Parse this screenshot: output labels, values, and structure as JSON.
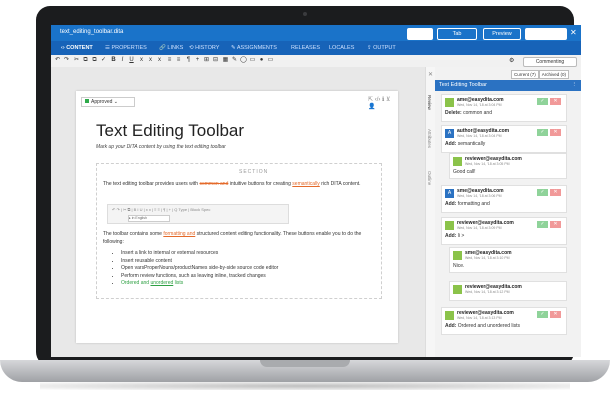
{
  "app": {
    "file_name": "text_editing_toolbar.dita",
    "buttons": {
      "oxygen": "Oxygen",
      "tab": "Tab",
      "preview": "Preview",
      "publish": "Publish",
      "close": "✕"
    }
  },
  "nav": [
    "CONTENT",
    "PROPERTIES",
    "LINKS",
    "HISTORY",
    "ASSIGNMENTS",
    "RELEASES",
    "LOCALES",
    "OUTPUT"
  ],
  "nav_icons": [
    "‹›",
    "☰",
    "🔗",
    "⟲",
    "✎",
    "",
    "",
    "⇪"
  ],
  "toolbar": {
    "tools": [
      "↶",
      "↷",
      "✂",
      "⧉",
      "⧉",
      "✓",
      "B",
      "I",
      "U",
      "x",
      "x",
      "x",
      "≡",
      "≡",
      "¶",
      "+",
      "⊞",
      "⊟",
      "▦",
      "✎",
      "◯",
      "▭",
      "●",
      "▭"
    ],
    "commenting": "Commenting",
    "gear": "⚙"
  },
  "doc": {
    "status": "Approved",
    "status_arrow": "⌄",
    "tools": "⇱ ‹/› ℹ ⊻",
    "person": "👤",
    "title": "Text Editing Toolbar",
    "shortdesc": "Mark up your DITA content by using the text editing toolbar",
    "section_label": "SECTION",
    "p1_a": "The text editing toolbar provides users with",
    "p1_strike": "common and",
    "p1_b": "intuitive buttons for creating",
    "p1_ins": "semantically",
    "p1_c": "rich DITA content.",
    "mini_row": "↶ ↷ | ✂ ⧉ | B I U | x x | ≡ ≡ | ¶ | + | Q Type | Block Spec",
    "mini_field": "▸ in English",
    "p2_a": "The toolbar contains some",
    "p2_ins": "formatting and",
    "p2_b": "structured content editing functionality. These buttons enable you to do the following:",
    "bullets": [
      "Insert a link to internal or external resources",
      "Insert reusable content",
      "Open varsProperNouns/productNames side-by-side source code editor",
      "Perform review functions, such as leaving inline, tracked changes"
    ],
    "bullet_last_a": "Ordered and ",
    "bullet_last_b": "unordered",
    "bullet_last_c": " lists"
  },
  "side_strip": [
    "Review",
    "Attributes",
    "Outline"
  ],
  "side_strip_close": "✕",
  "review": {
    "tabs": [
      "Current (7)",
      "Archived (0)"
    ],
    "header": "Text Editing Toolbar",
    "header_more": "⋮",
    "ok_label": "✓",
    "no_label": "✕",
    "cards": [
      {
        "avatar": "",
        "who": "ame@easydita.com",
        "when": "Wed, Nov 14, '18 at 3:04 PM",
        "msg_label": "Delete:",
        "msg": "common and",
        "blue": false
      },
      {
        "avatar": "A",
        "who": "author@easydita.com",
        "when": "Wed, Nov 14, '18 at 3:04 PM",
        "msg_label": "Add:",
        "msg": "semantically",
        "blue": true
      },
      {
        "avatar": "",
        "who": "reviewer@easydita.com",
        "when": "Wed, Nov 14, '18 at 3:05 PM",
        "msg_label": "",
        "msg": "Good call!",
        "blue": false
      },
      {
        "avatar": "A",
        "who": "sme@easydita.com",
        "when": "Wed, Nov 14, '18 at 3:06 PM",
        "msg_label": "Add:",
        "msg": "formatting and",
        "blue": true
      },
      {
        "avatar": "",
        "who": "reviewer@easydita.com",
        "when": "Wed, Nov 14, '18 at 3:09 PM",
        "msg_label": "Add:",
        "msg": "li >",
        "blue": false
      },
      {
        "avatar": "",
        "who": "sme@easydita.com",
        "when": "Wed, Nov 14, '18 at 3:10 PM",
        "msg_label": "",
        "msg": "Nice.",
        "blue": false
      },
      {
        "avatar": "",
        "who": "reviewer@easydita.com",
        "when": "Wed, Nov 14, '18 at 3:12 PM",
        "msg_label": "",
        "msg": "",
        "blue": false
      },
      {
        "avatar": "",
        "who": "reviewer@easydita.com",
        "when": "Wed, Nov 14, '18 at 3:13 PM",
        "msg_label": "Add:",
        "msg": "Ordered and unordered lists",
        "blue": false
      }
    ]
  }
}
